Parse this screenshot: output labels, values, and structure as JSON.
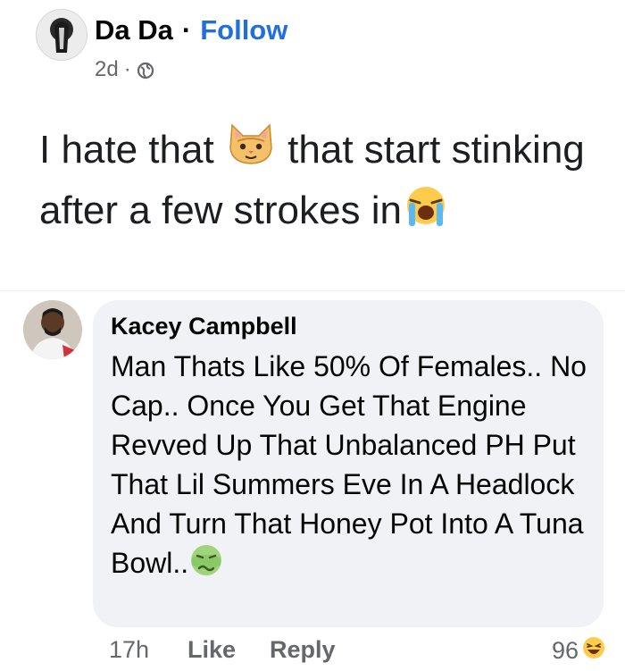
{
  "post": {
    "author": "Da Da",
    "separator": "·",
    "follow_label": "Follow",
    "timestamp": "2d",
    "meta_separator": "·",
    "privacy_icon": "globe-icon",
    "text_part1": "I hate that ",
    "emoji1": "cat-face-emoji",
    "text_part2": " that start stinking after a few strokes in",
    "emoji2": "loudly-crying-face-emoji"
  },
  "comment": {
    "author": "Kacey Campbell",
    "text": "Man Thats Like 50% Of Females.. No Cap.. Once You Get That Engine Revved Up That Unbalanced PH Put That Lil Summers Eve In A Headlock And Turn That Honey Pot Into A Tuna Bowl..",
    "emoji": "nauseated-face-emoji",
    "timestamp": "17h",
    "like_label": "Like",
    "reply_label": "Reply",
    "reaction_count": "96",
    "reaction_icon": "laughing-face-emoji"
  },
  "colors": {
    "link_blue": "#216fdb",
    "meta_gray": "#65676b",
    "bubble_bg": "#f0f2f5"
  }
}
